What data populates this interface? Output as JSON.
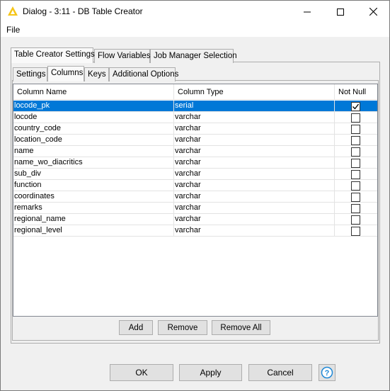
{
  "window": {
    "title": "Dialog - 3:11 - DB Table Creator"
  },
  "menu": {
    "file": "File"
  },
  "outer_tabs": [
    {
      "label": "Table Creator Settings",
      "active": true
    },
    {
      "label": "Flow Variables",
      "active": false
    },
    {
      "label": "Job Manager Selection",
      "active": false
    }
  ],
  "inner_tabs": [
    {
      "label": "Settings",
      "active": false
    },
    {
      "label": "Columns",
      "active": true
    },
    {
      "label": "Keys",
      "active": false
    },
    {
      "label": "Additional Options",
      "active": false
    }
  ],
  "table": {
    "headers": [
      "Column Name",
      "Column Type",
      "Not Null"
    ],
    "rows": [
      {
        "name": "locode_pk",
        "type": "serial",
        "not_null": true,
        "selected": true
      },
      {
        "name": "locode",
        "type": "varchar",
        "not_null": false
      },
      {
        "name": "country_code",
        "type": "varchar",
        "not_null": false
      },
      {
        "name": "location_code",
        "type": "varchar",
        "not_null": false
      },
      {
        "name": "name",
        "type": "varchar",
        "not_null": false
      },
      {
        "name": "name_wo_diacritics",
        "type": "varchar",
        "not_null": false
      },
      {
        "name": "sub_div",
        "type": "varchar",
        "not_null": false
      },
      {
        "name": "function",
        "type": "varchar",
        "not_null": false
      },
      {
        "name": "coordinates",
        "type": "varchar",
        "not_null": false
      },
      {
        "name": "remarks",
        "type": "varchar",
        "not_null": false
      },
      {
        "name": "regional_name",
        "type": "varchar",
        "not_null": false
      },
      {
        "name": "regional_level",
        "type": "varchar",
        "not_null": false
      }
    ]
  },
  "table_buttons": {
    "add": "Add",
    "remove": "Remove",
    "remove_all": "Remove All"
  },
  "dialog_buttons": {
    "ok": "OK",
    "apply": "Apply",
    "cancel": "Cancel"
  },
  "icons": {
    "app": "knime-triangle-icon",
    "help": "help-icon"
  },
  "colors": {
    "selection": "#0078d7",
    "app_icon": "#f5c518",
    "help": "#1e88d6"
  }
}
